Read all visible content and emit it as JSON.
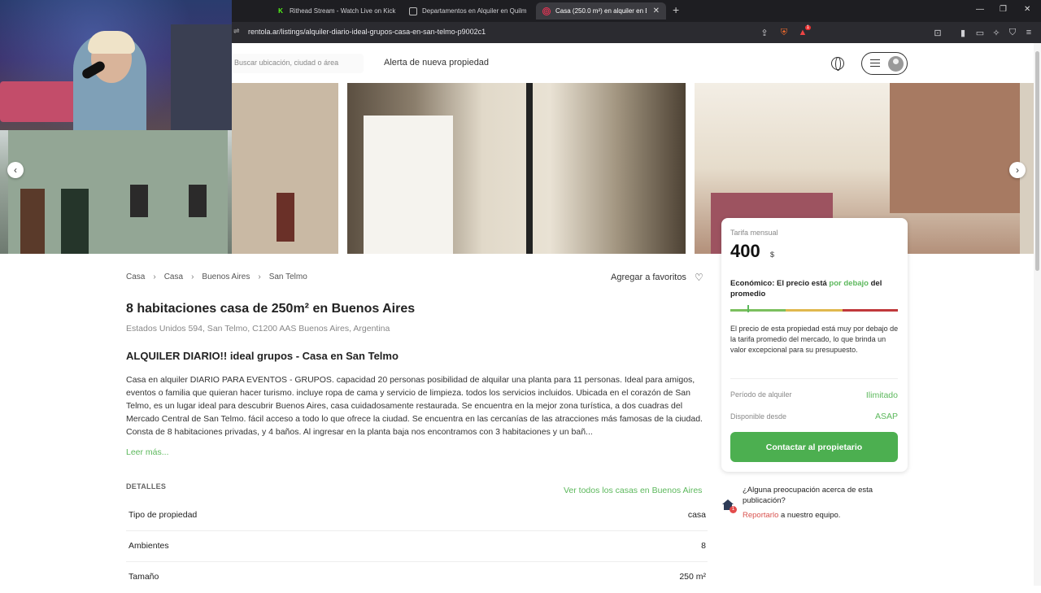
{
  "browser": {
    "tabs": [
      {
        "label": "Rithead Stream - Watch Live on Kick",
        "icon": "kick-icon",
        "active": false
      },
      {
        "label": "Departamentos en Alquiler en Quilm",
        "icon": "page-icon",
        "active": false
      },
      {
        "label": "Casa (250.0 m²) en alquiler en Bu",
        "icon": "rentola-icon",
        "active": true
      }
    ],
    "url": "rentola.ar/listings/alquiler-diario-ideal-grupos-casa-en-san-telmo-p9002c1",
    "extension_badge": "1"
  },
  "header": {
    "search_placeholder": "Buscar ubicación, ciudad o área",
    "alert_link": "Alerta de nueva propiedad"
  },
  "breadcrumbs": [
    "Casa",
    "Casa",
    "Buenos Aires",
    "San Telmo"
  ],
  "favorite_label": "Agregar a favoritos",
  "listing": {
    "title": "8 habitaciones casa de 250m² en Buenos Aires",
    "address": "Estados Unidos 594, San Telmo, C1200 AAS Buenos Aires, Argentina",
    "subtitle": "ALQUILER DIARIO!! ideal grupos - Casa en San Telmo",
    "description": "Casa en alquiler DIARIO PARA EVENTOS - GRUPOS. capacidad 20 personas posibilidad de alquilar una planta para 11 personas. Ideal para amigos, eventos o familia que quieran hacer turismo. incluye ropa de cama y servicio de limpieza. todos los servicios incluidos. Ubicada en el corazón de San Telmo, es un lugar ideal para descubrir Buenos Aires, casa cuidadosamente restaurada. Se encuentra en la mejor zona turística, a dos cuadras del Mercado Central de San Telmo. fácil acceso a todo lo que ofrece la ciudad. Se encuentra en las cercanías de las atracciones más famosas de la ciudad. Consta de 8 habitaciones privadas, y 4 baños. Al ingresar en la planta baja nos encontramos con 3 habitaciones y un bañ...",
    "read_more": "Leer más..."
  },
  "details": {
    "heading": "DETALLES",
    "all_link": "Ver todos los casas en Buenos Aires",
    "rows": [
      {
        "key": "Tipo de propiedad",
        "value": "casa"
      },
      {
        "key": "Ambientes",
        "value": "8"
      },
      {
        "key": "Tamaño",
        "value": "250 m²"
      }
    ]
  },
  "price_card": {
    "label": "Tarifa mensual",
    "price": "400",
    "currency": "$",
    "eco_prefix": "Económico: El precio está ",
    "eco_highlight": "por debajo",
    "eco_suffix": " del promedio",
    "explanation": "El precio de esta propiedad está muy por debajo de la tarifa promedio del mercado, lo que brinda un valor excepcional para su presupuesto.",
    "period_label": "Período de alquiler",
    "period_value": "Ilimitado",
    "available_label": "Disponible desde",
    "available_value": "ASAP",
    "contact_button": "Contactar al propietario",
    "price_position_pct": 10
  },
  "report": {
    "question": "¿Alguna preocupación acerca de esta publicación?",
    "link": "Reportarlo",
    "suffix": " a nuestro equipo.",
    "badge": "1"
  },
  "colors": {
    "accent_green": "#4caf50",
    "link_green": "#5cb85c",
    "report_red": "#d9534f"
  }
}
